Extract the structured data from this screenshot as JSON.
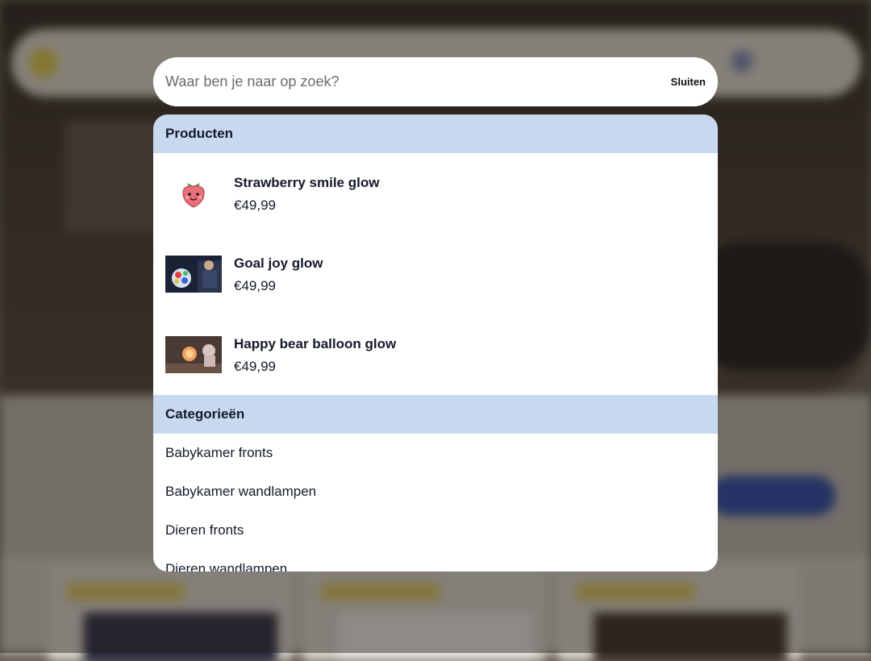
{
  "search": {
    "placeholder": "Waar ben je naar op zoek?",
    "close_label": "Sluiten"
  },
  "products": {
    "header": "Producten",
    "items": [
      {
        "name": "Strawberry smile glow",
        "price": "€49,99",
        "thumb": "strawberry-thumbnail"
      },
      {
        "name": "Goal joy glow",
        "price": "€49,99",
        "thumb": "football-lamp-thumbnail"
      },
      {
        "name": "Happy bear balloon glow",
        "price": "€49,99",
        "thumb": "bear-lamp-thumbnail"
      }
    ]
  },
  "categories": {
    "header": "Categorieën",
    "items": [
      "Babykamer fronts",
      "Babykamer wandlampen",
      "Dieren fronts",
      "Dieren wandlampen"
    ]
  },
  "colors": {
    "section_header_bg": "#c8d8ee",
    "text": "#141a2a",
    "overlay": "#ffffff"
  }
}
